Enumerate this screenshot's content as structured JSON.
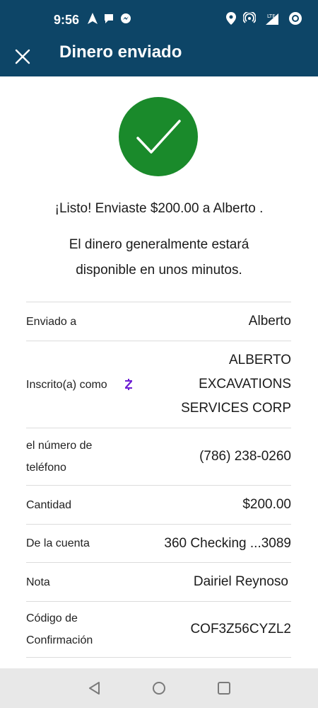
{
  "status": {
    "time": "9:56",
    "lte": "LTE"
  },
  "appbar": {
    "title": "Dinero enviado"
  },
  "confirmation": {
    "headline": "¡Listo! Enviaste $200.00 a Alberto .",
    "subtext": "El dinero generalmente estará disponible en unos minutos."
  },
  "details": {
    "sent_to": {
      "label": "Enviado a",
      "value": "Alberto"
    },
    "enrolled_as": {
      "label": "Inscrito(a) como",
      "value": "ALBERTO EXCAVATIONS SERVICES CORP"
    },
    "phone": {
      "label": "el número de teléfono",
      "value": "(786) 238-0260"
    },
    "amount": {
      "label": "Cantidad",
      "value": "$200.00"
    },
    "from_account": {
      "label": "De la cuenta",
      "value": "360 Checking ...3089"
    },
    "note": {
      "label": "Nota",
      "value": "Dairiel Reynoso"
    },
    "confirmation_code": {
      "label": "Código de Confirmación",
      "value": "COF3Z56CYZL2"
    }
  },
  "colors": {
    "header": "#0d4567",
    "success": "#1a8a2b",
    "zelle": "#6d1ed4"
  }
}
